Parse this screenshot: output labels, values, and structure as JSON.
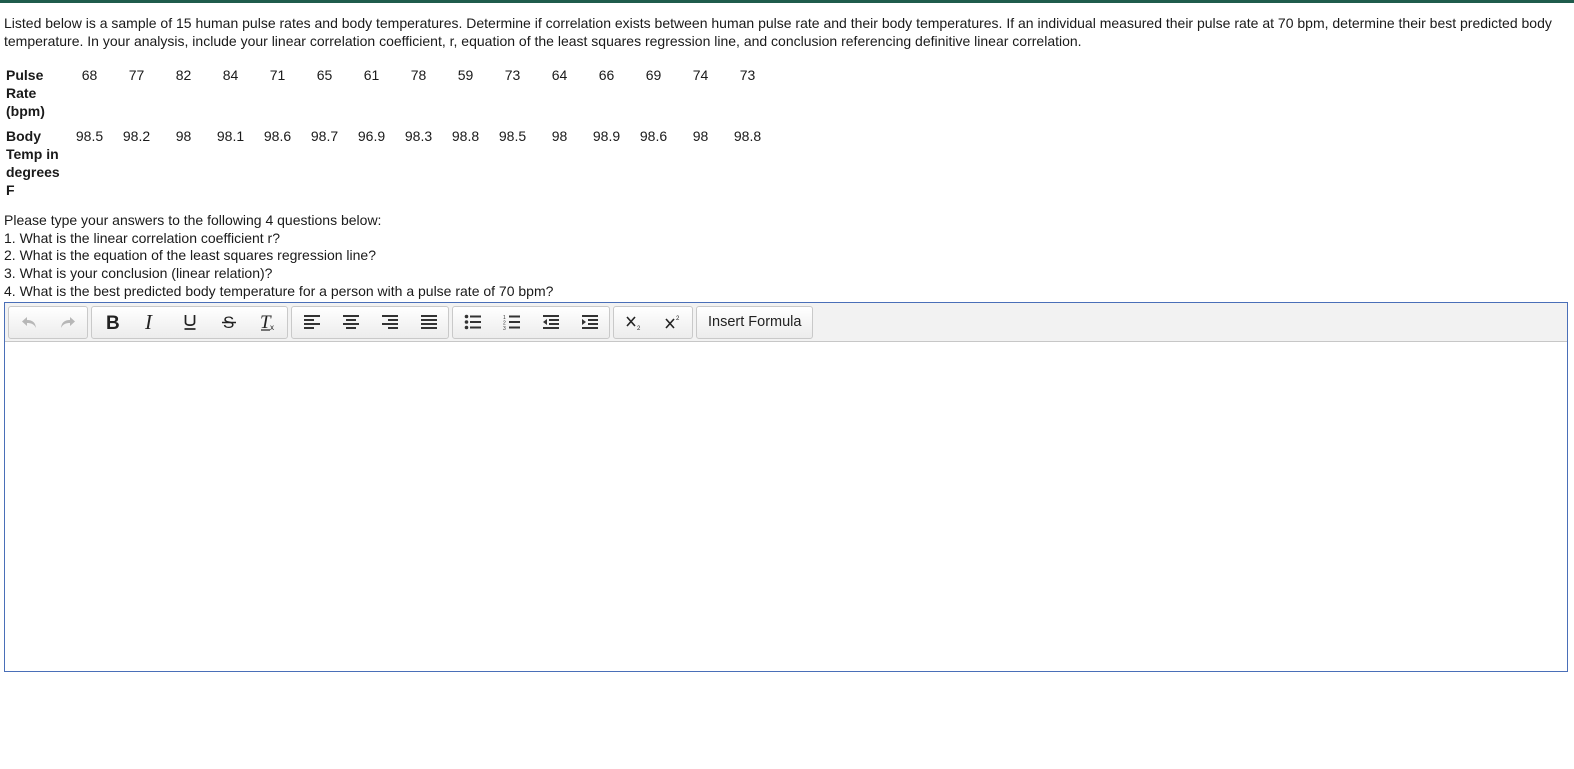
{
  "prompt": "Listed below is a sample of 15 human pulse rates and body temperatures.  Determine if correlation exists between human pulse rate and their body temperatures.  If an individual measured their pulse rate at 70 bpm, determine their best predicted body temperature.  In your analysis, include your linear correlation coefficient, r, equation of the least squares regression line, and conclusion referencing definitive linear correlation.",
  "table": {
    "rows": [
      {
        "header_lines": [
          "Pulse",
          "Rate",
          "(bpm)"
        ],
        "values": [
          "68",
          "77",
          "82",
          "84",
          "71",
          "65",
          "61",
          "78",
          "59",
          "73",
          "64",
          "66",
          "69",
          "74",
          "73"
        ]
      },
      {
        "header_lines": [
          "Body",
          "Temp in",
          "degrees",
          "F"
        ],
        "values": [
          "98.5",
          "98.2",
          "98",
          "98.1",
          "98.6",
          "98.7",
          "96.9",
          "98.3",
          "98.8",
          "98.5",
          "98",
          "98.9",
          "98.6",
          "98",
          "98.8"
        ]
      }
    ]
  },
  "instructions": "Please type your answers to the following 4 questions below:",
  "questions": [
    "1.  What is the linear correlation coefficient r?",
    "2.  What is the equation of the least squares regression line?",
    "3.  What is your conclusion (linear relation)?",
    "4.  What is the best predicted body temperature for a person with a pulse rate of 70 bpm?"
  ],
  "editor": {
    "insert_formula_label": "Insert Formula",
    "toolbar_icons": [
      "undo-icon",
      "redo-icon",
      "bold-icon",
      "italic-icon",
      "underline-icon",
      "strikethrough-icon",
      "clear-formatting-icon",
      "align-left-icon",
      "align-center-icon",
      "align-right-icon",
      "align-justify-icon",
      "bullet-list-icon",
      "numbered-list-icon",
      "outdent-icon",
      "indent-icon",
      "subscript-icon",
      "superscript-icon"
    ],
    "body_text": ""
  },
  "colors": {
    "top_rule": "#1f5c4c",
    "editor_border": "#4a6fb8",
    "toolbar_bg": "#f2f2f2"
  }
}
